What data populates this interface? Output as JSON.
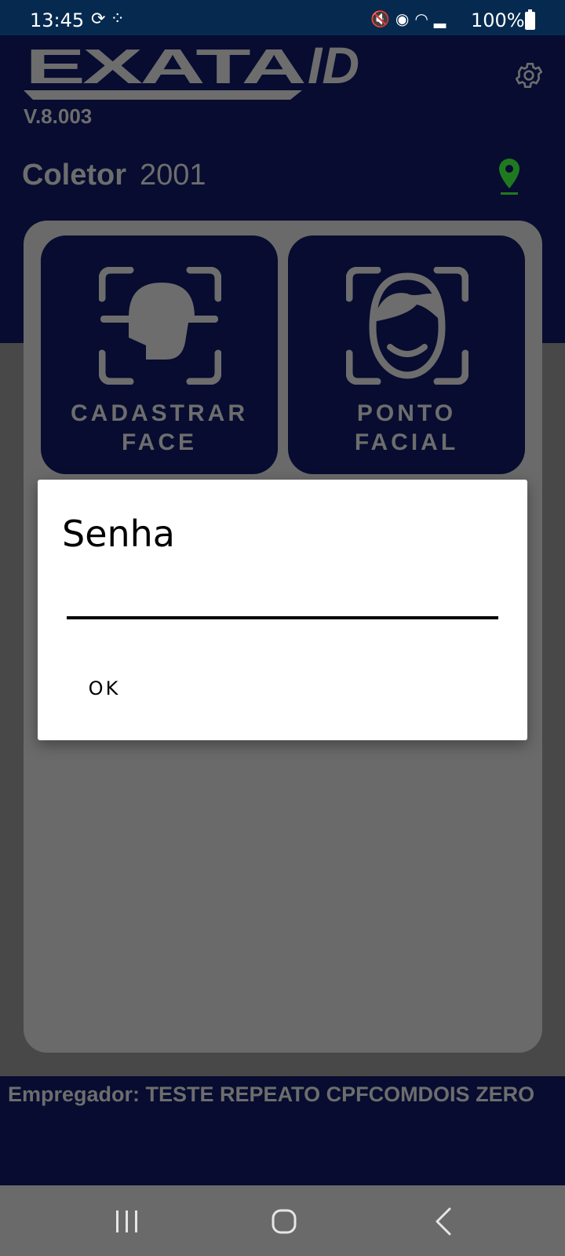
{
  "status_bar": {
    "time": "13:45",
    "battery": "100%",
    "left_icons": [
      "sync-icon",
      "app-grid-icon"
    ],
    "right_icons": [
      "mute-icon",
      "location-icon",
      "wifi-icon",
      "signal-icon",
      "battery-icon"
    ]
  },
  "header": {
    "logo_text": "EXATAID",
    "version": "V.8.003",
    "coletor_label": "Coletor",
    "coletor_value": "2001"
  },
  "tiles": [
    {
      "label": "CADASTRAR\nFACE",
      "icon": "face-register-icon"
    },
    {
      "label": "PONTO\nFACIAL",
      "icon": "face-scan-icon"
    }
  ],
  "footer": {
    "empregador": "Empregador: TESTE REPEATO CPFCOMDOIS ZERO"
  },
  "dialog": {
    "title": "Senha",
    "input_value": "",
    "ok_label": "OK"
  },
  "colors": {
    "header_bg": "#070c30",
    "status_bar_bg": "#062a4f",
    "muted_text": "#6d6d6d",
    "pin_green": "#1f7a1f",
    "panel_bg": "#6a6a6a"
  }
}
